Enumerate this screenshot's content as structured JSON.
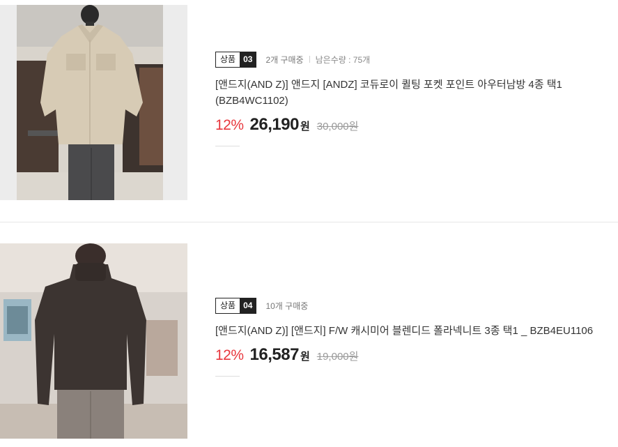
{
  "products": [
    {
      "badge_label": "상품",
      "badge_number": "03",
      "purchase_count": "2개 구매중",
      "remaining": "남은수량 : 75개",
      "title": "[앤드지(AND Z)] 앤드지 [ANDZ] 코듀로이 퀼팅 포켓 포인트 아우터남방 4종 택1 (BZB4WC1102)",
      "discount": "12%",
      "price": "26,190",
      "currency": "원",
      "original_price": "30,000원",
      "image_alt": "beige corduroy shirt on mannequin"
    },
    {
      "badge_label": "상품",
      "badge_number": "04",
      "purchase_count": "10개 구매중",
      "title": "[앤드지(AND Z)] [앤드지] F/W 캐시미어 블렌디드 폴라넥니트 3종 택1 _ BZB4EU1106",
      "discount": "12%",
      "price": "16,587",
      "currency": "원",
      "original_price": "19,000원",
      "image_alt": "dark brown turtleneck knit on mannequin"
    }
  ],
  "colors": {
    "discount": "#e8383e",
    "badge_dark": "#222222",
    "meta_text": "#777777"
  }
}
